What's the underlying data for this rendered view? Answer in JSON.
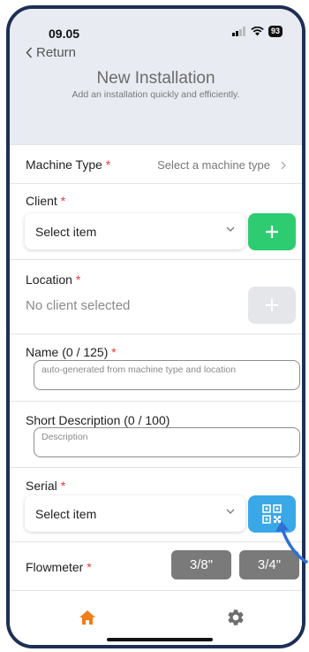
{
  "status": {
    "time": "09.05",
    "battery": "93"
  },
  "nav": {
    "back_label": "Return"
  },
  "header": {
    "title": "New Installation",
    "subtitle": "Add an installation quickly and efficiently."
  },
  "machine_type": {
    "label": "Machine Type",
    "value": "Select a machine type"
  },
  "client": {
    "label": "Client",
    "value": "Select item"
  },
  "location": {
    "label": "Location",
    "value": "No client selected"
  },
  "name": {
    "label": "Name (0 / 125)",
    "placeholder": "auto-generated from machine type and location"
  },
  "short_description": {
    "label": "Short Description (0 / 100)",
    "placeholder": "Description"
  },
  "serial": {
    "label": "Serial",
    "value": "Select item"
  },
  "flowmeter": {
    "label": "Flowmeter",
    "options": [
      "3/8\"",
      "3/4\""
    ]
  },
  "required_mark": "*",
  "colors": {
    "accent_green": "#2ecc71",
    "scan_blue": "#3aa8e6",
    "tab_active": "#ef7d1a",
    "frame": "#1d2f55"
  },
  "bottom_nav": {
    "items": [
      {
        "icon": "home-icon",
        "active": true
      },
      {
        "icon": "gear-icon",
        "active": false
      }
    ]
  }
}
